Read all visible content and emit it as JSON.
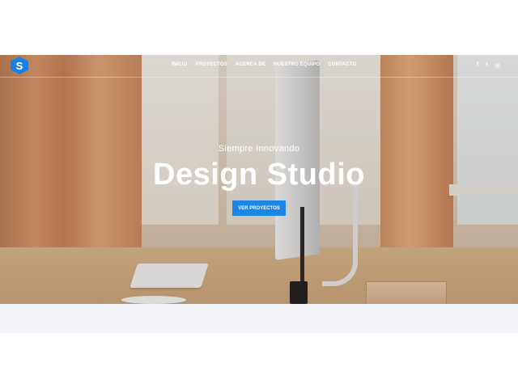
{
  "brand": {
    "logo_letter": "S",
    "accent_color": "#1d7fe0"
  },
  "nav": {
    "items": [
      "INICIO",
      "PROYECTOS",
      "ACERCA DE",
      "NUESTRO EQUIPO",
      "CONTACTO"
    ]
  },
  "social": {
    "facebook": "f",
    "twitter": "t",
    "instagram": "◎",
    "icons": [
      "facebook-icon",
      "twitter-icon",
      "instagram-icon"
    ]
  },
  "hero": {
    "subtitle": "Siempre Innovando",
    "title": "Design Studio",
    "cta_label": "VER PROYECTOS",
    "cta_color": "#1c86e6"
  }
}
